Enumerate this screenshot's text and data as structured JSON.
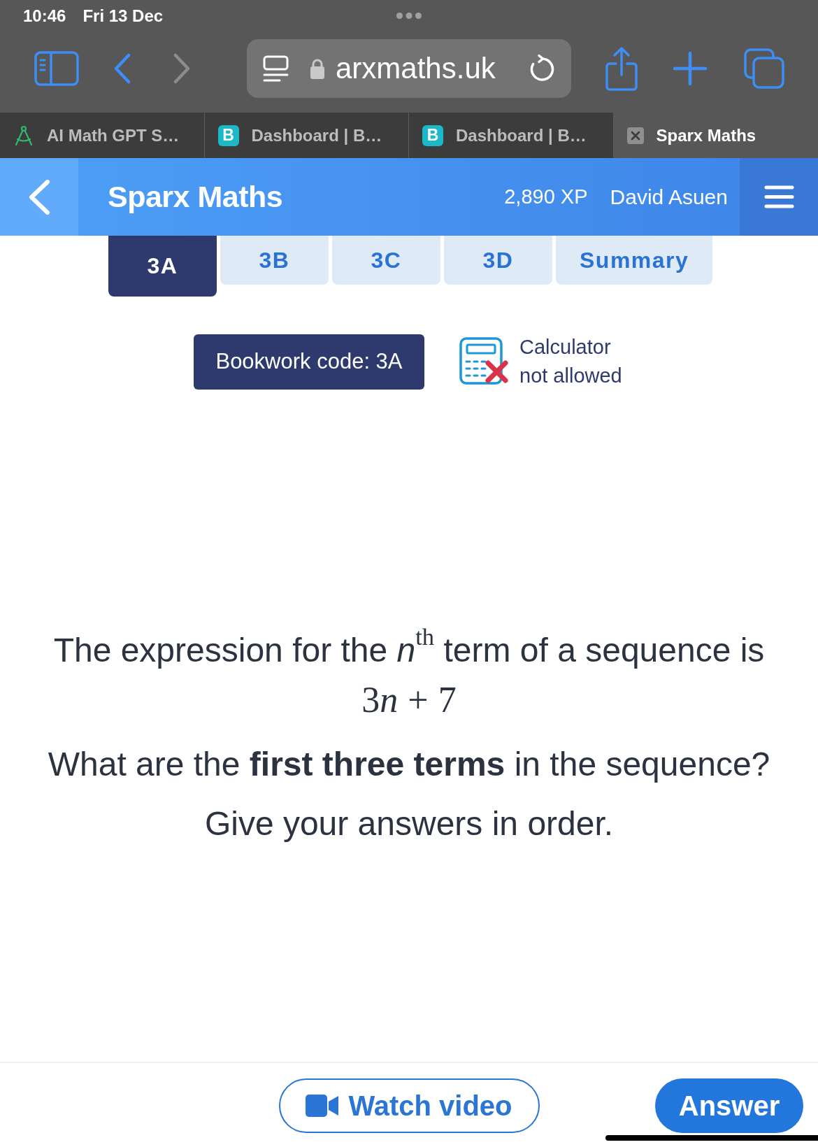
{
  "status_bar": {
    "time": "10:46",
    "date": "Fri 13 Dec"
  },
  "address_bar": {
    "url": "arxmaths.uk"
  },
  "browser_tabs": [
    {
      "title": "AI Math GPT S…",
      "kind": "compass",
      "selected": false
    },
    {
      "title": "Dashboard | B…",
      "kind": "letter",
      "badge": "B",
      "selected": false
    },
    {
      "title": "Dashboard | B…",
      "kind": "letter",
      "badge": "B",
      "selected": false
    },
    {
      "title": "Sparx Maths",
      "kind": "close",
      "selected": true
    }
  ],
  "header": {
    "title": "Sparx Maths",
    "xp": "2,890 XP",
    "user": "David Asuen"
  },
  "task_tabs": [
    {
      "label": "3A",
      "selected": true
    },
    {
      "label": "3B",
      "selected": false
    },
    {
      "label": "3C",
      "selected": false
    },
    {
      "label": "3D",
      "selected": false
    },
    {
      "label": "Summary",
      "selected": false
    }
  ],
  "bookwork": {
    "label": "Bookwork code: 3A"
  },
  "calculator": {
    "allowed": false,
    "note": "Calculator not allowed"
  },
  "question": {
    "statement": "The expression for the *n*$^{th}$ term of a sequence is",
    "expression": [
      {
        "text": "3",
        "kind": "number"
      },
      {
        "text": "n",
        "kind": "variable"
      },
      {
        "text": "+",
        "kind": "operator"
      },
      {
        "text": "7",
        "kind": "number"
      }
    ],
    "prompt": "What are the **first three terms** in the sequence?",
    "instruction": "Give your answers in order."
  },
  "actions": [
    {
      "label": "Watch video",
      "kind": "outline"
    },
    {
      "label": "Answer",
      "kind": "primary"
    }
  ]
}
